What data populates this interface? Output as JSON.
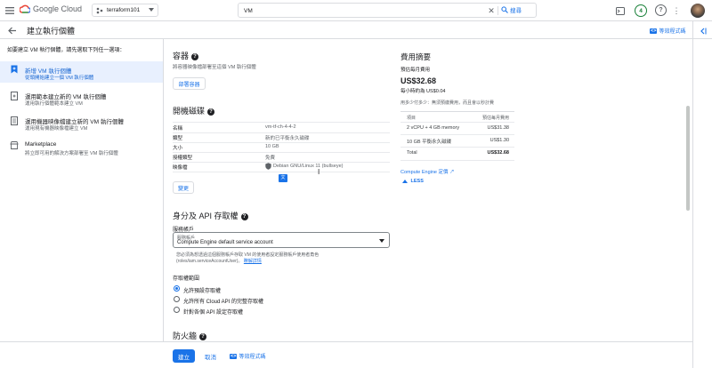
{
  "topbar": {
    "product": "Google Cloud",
    "project": "terraform101",
    "search_value": "VM",
    "search_button": "搜尋",
    "notifications_count": "4"
  },
  "header": {
    "title": "建立執行個體",
    "equivalent_code": "等效程式碼"
  },
  "sidebar": {
    "heading": "如要建立 VM 執行個體，請先選取下列任一選項：",
    "items": [
      {
        "title": "新增 VM 執行個體",
        "subtitle": "從頭開始建立一個 VM 執行個體"
      },
      {
        "title": "運用範本建立新的 VM 執行個體",
        "subtitle": "運用執行個體範本建立 VM"
      },
      {
        "title": "運用機器映像檔建立新的 VM 執行個體",
        "subtitle": "運用現有機器映像檔建立 VM"
      },
      {
        "title": "Marketplace",
        "subtitle": "將立即可用的解決方案部署至 VM 執行個體"
      }
    ]
  },
  "container": {
    "title": "容器",
    "desc": "將容器映像檔部署至這個 VM 執行個體",
    "button": "部署容器"
  },
  "boot_disk": {
    "title": "開機磁碟",
    "rows": [
      {
        "key": "名稱",
        "value": "vm-tf-ch-4-4-2"
      },
      {
        "key": "類型",
        "value": "新的已平衡永久磁碟"
      },
      {
        "key": "大小",
        "value": "10 GB"
      },
      {
        "key": "授權類型",
        "value": "免費"
      },
      {
        "key": "映像檔",
        "value": "Debian GNU/Linux 11 (bullseye)"
      }
    ],
    "button": "變更"
  },
  "identity": {
    "title": "身分及 API 存取權",
    "sa_label": "服務帳戶",
    "sa_field_label": "服務帳戶",
    "sa_value": "Compute Engine default service account",
    "note1": "您必須為想透過這個服務帳戶存取 VM 的使用者設定服務帳戶使用者角色",
    "note2": "(roles/iam.serviceAccountUser)。",
    "note_link": "瞭解詳情",
    "scope_label": "存取權範圍",
    "scopes": [
      "允許預設存取權",
      "允許所有 Cloud API 的完整存取權",
      "針對各個 API 設定存取權"
    ]
  },
  "firewall": {
    "title": "防火牆"
  },
  "cost": {
    "title": "費用摘要",
    "monthly_label": "預估每月費用",
    "monthly_value": "US$32.68",
    "hourly": "每小時約為 US$0.04",
    "note": "用多少付多少：無須預繳費用，而且會以秒計費",
    "col_item": "項目",
    "col_cost": "預估每月費用",
    "rows": [
      {
        "item": "2 vCPU + 4 GB memory",
        "cost": "US$31.38"
      },
      {
        "item": "10 GB 平衡永久磁碟",
        "cost": "US$1.30"
      },
      {
        "item": "Total",
        "cost": "US$32.68"
      }
    ],
    "pricing_link": "Compute Engine 定價",
    "less": "LESS"
  },
  "footer": {
    "create": "建立",
    "cancel": "取消",
    "equivalent_code": "等效程式碼"
  },
  "colors": {
    "accent": "#1a73e8",
    "selected_bg": "#e8f0fe"
  },
  "icons": [
    "hamburger-menu-icon",
    "project-icon",
    "search-icon",
    "clear-icon",
    "terminal-icon",
    "help-icon",
    "more-vert-icon",
    "back-arrow-icon",
    "code-icon",
    "shield-icon",
    "translate-icon",
    "collapse-panel-icon"
  ]
}
